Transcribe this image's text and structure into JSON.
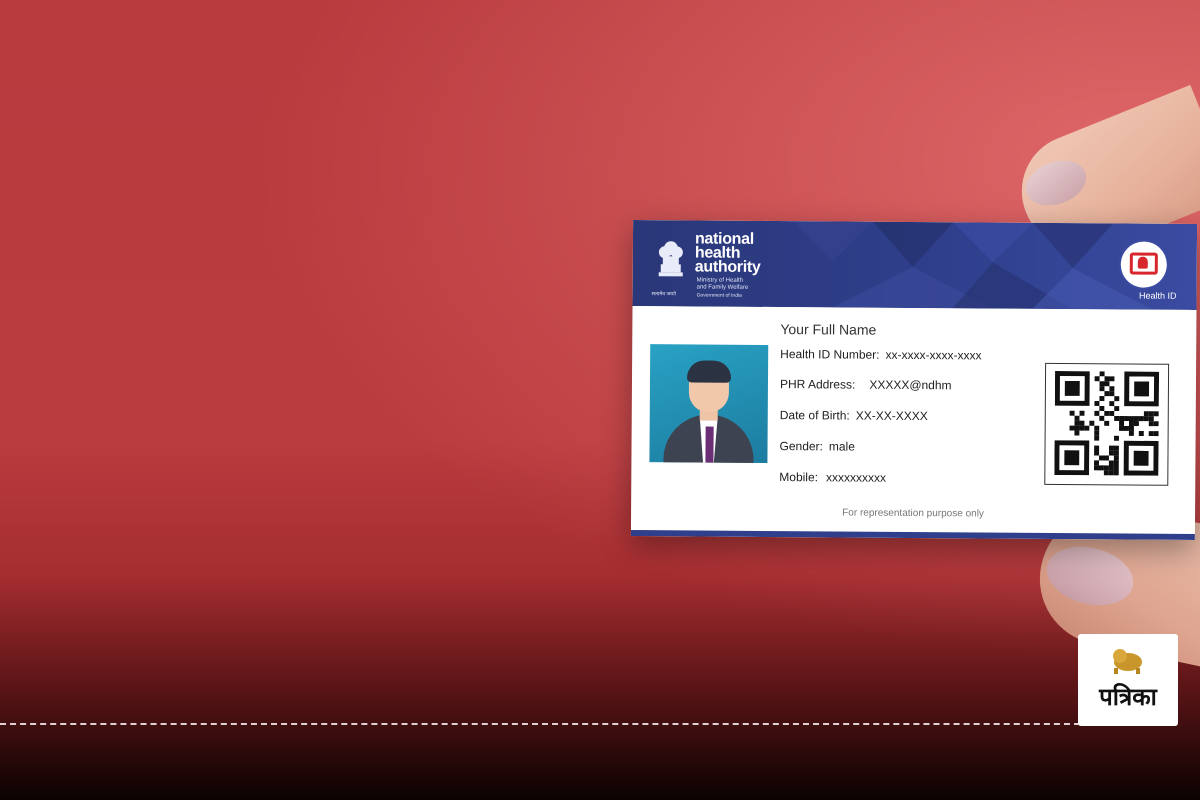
{
  "card": {
    "org_title_lines": [
      "national",
      "health",
      "authority"
    ],
    "org_subtitle_lines": [
      "Ministry of Health",
      "and Family Welfare"
    ],
    "government_line": "Government of India",
    "emblem_caption": "सत्यमेव जयते",
    "health_id_label": "Health ID",
    "full_name": "Your Full Name",
    "fields": {
      "health_id_number": {
        "label": "Health ID Number:",
        "value": "xx-xxxx-xxxx-xxxx"
      },
      "phr_address": {
        "label": "PHR Address:",
        "value": "XXXXX@ndhm"
      },
      "date_of_birth": {
        "label": "Date of Birth:",
        "value": "XX-XX-XXXX"
      },
      "gender": {
        "label": "Gender:",
        "value": "male"
      },
      "mobile": {
        "label": "Mobile:",
        "value": "xxxxxxxxxx"
      }
    },
    "disclaimer": "For representation purpose only",
    "colors": {
      "header": "#2f3f8c",
      "logo_red": "#d8262d",
      "photo_bg": "#29a2c4"
    }
  },
  "watermark": {
    "brand": "पत्रिका"
  },
  "background": {
    "color": "#b73a3d"
  }
}
